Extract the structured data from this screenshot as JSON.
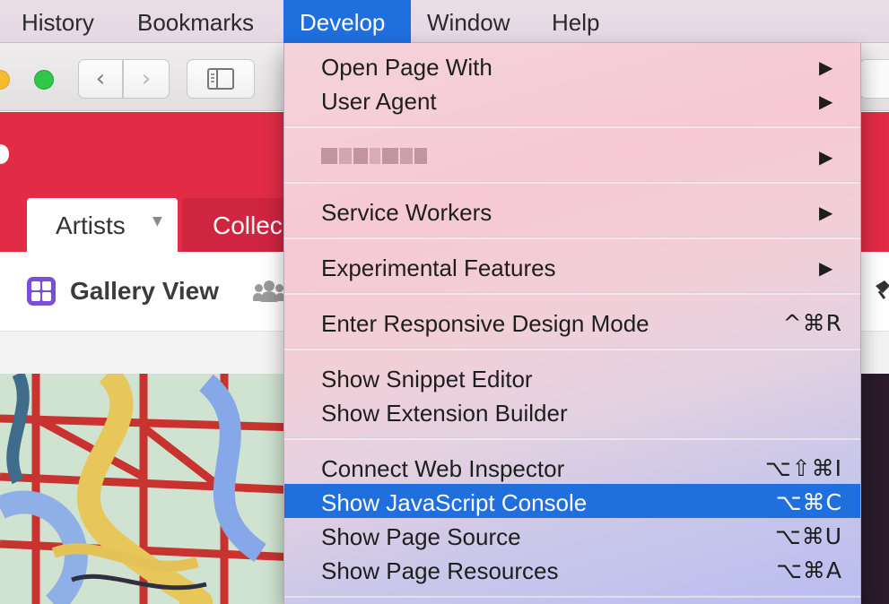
{
  "menubar": {
    "items": [
      "History",
      "Bookmarks",
      "Develop",
      "Window",
      "Help"
    ],
    "active": "Develop"
  },
  "toolbar": {
    "back_glyph": "‹",
    "forward_glyph": "›",
    "sidebar_icon": "sidebar-icon"
  },
  "site": {
    "tabs": [
      "Artists",
      "Collec"
    ],
    "view_label": "Gallery View",
    "accent_color": "#e22c46",
    "view_icon_color": "#7a4fd6"
  },
  "develop_menu": {
    "highlight_color": "#1f6fde",
    "items": [
      {
        "label": "Open Page With",
        "submenu": true
      },
      {
        "label": "User Agent",
        "submenu": true
      },
      {
        "label": "",
        "submenu": true,
        "redacted": true
      },
      {
        "label": "Service Workers",
        "submenu": true
      },
      {
        "label": "Experimental Features",
        "submenu": true
      },
      {
        "label": "Enter Responsive Design Mode",
        "shortcut": "^⌘R"
      },
      {
        "label": "Show Snippet Editor"
      },
      {
        "label": "Show Extension Builder"
      },
      {
        "label": "Connect Web Inspector",
        "shortcut": "⌥⇧⌘I"
      },
      {
        "label": "Show JavaScript Console",
        "shortcut": "⌥⌘C",
        "highlighted": true
      },
      {
        "label": "Show Page Source",
        "shortcut": "⌥⌘U"
      },
      {
        "label": "Show Page Resources",
        "shortcut": "⌥⌘A"
      }
    ],
    "submenu_arrow": "▶"
  }
}
